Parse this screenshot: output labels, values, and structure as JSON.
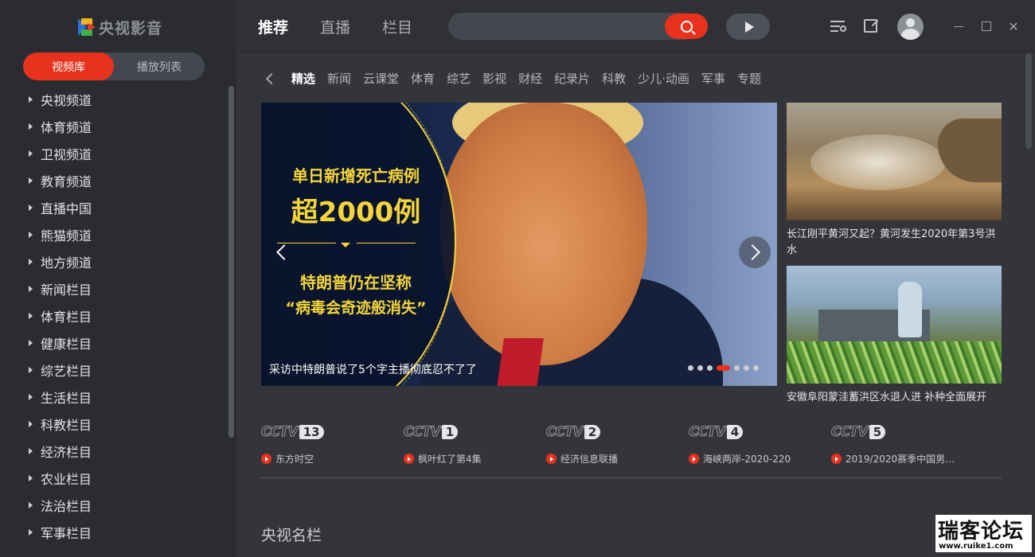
{
  "app": {
    "name": "央视影音"
  },
  "sidebar": {
    "tabs": [
      {
        "label": "视频库"
      },
      {
        "label": "播放列表"
      }
    ],
    "items": [
      {
        "label": "央视频道"
      },
      {
        "label": "体育频道"
      },
      {
        "label": "卫视频道"
      },
      {
        "label": "教育频道"
      },
      {
        "label": "直播中国"
      },
      {
        "label": "熊猫频道"
      },
      {
        "label": "地方频道"
      },
      {
        "label": "新闻栏目"
      },
      {
        "label": "体育栏目"
      },
      {
        "label": "健康栏目"
      },
      {
        "label": "综艺栏目"
      },
      {
        "label": "生活栏目"
      },
      {
        "label": "科教栏目"
      },
      {
        "label": "经济栏目"
      },
      {
        "label": "农业栏目"
      },
      {
        "label": "法治栏目"
      },
      {
        "label": "军事栏目"
      }
    ]
  },
  "topnav": [
    {
      "label": "推荐"
    },
    {
      "label": "直播"
    },
    {
      "label": "栏目"
    }
  ],
  "search": {
    "value": "",
    "placeholder": ""
  },
  "categories": [
    {
      "label": "精选"
    },
    {
      "label": "新闻"
    },
    {
      "label": "云课堂"
    },
    {
      "label": "体育"
    },
    {
      "label": "综艺"
    },
    {
      "label": "影视"
    },
    {
      "label": "财经"
    },
    {
      "label": "纪录片"
    },
    {
      "label": "科教"
    },
    {
      "label": "少儿·动画"
    },
    {
      "label": "军事"
    },
    {
      "label": "专题"
    }
  ],
  "banner": {
    "line1": "单日新增死亡病例",
    "line2": "超2000例",
    "line3": "特朗普仍在坚称",
    "line4": "“病毒会奇迹般消失”",
    "caption": "采访中特朗普说了5个字主播彻底忍不了了",
    "slides_total": 7,
    "active_slide": 4
  },
  "side_items": [
    {
      "caption": "长江刚平黄河又起？黄河发生2020年第3号洪水"
    },
    {
      "caption": "安徽阜阳蒙洼蓄洪区水退人进 补种全面展开"
    }
  ],
  "channels": [
    {
      "logo": "CCTV",
      "number": "13",
      "program": "东方时空"
    },
    {
      "logo": "CCTV",
      "number": "1",
      "program": "枫叶红了第4集"
    },
    {
      "logo": "CCTV",
      "number": "2",
      "program": "经济信息联播"
    },
    {
      "logo": "CCTV",
      "number": "4",
      "program": "海峡两岸-2020-220"
    },
    {
      "logo": "CCTV",
      "number": "5",
      "program": "2019/2020赛季中国男…"
    }
  ],
  "section_title": "央视名栏",
  "watermark": {
    "title": "瑞客论坛",
    "url": "www.ruike1.com"
  },
  "colors": {
    "accent": "#e8321d",
    "sidebar_bg": "#2a2c31",
    "main_bg": "#33353b"
  }
}
